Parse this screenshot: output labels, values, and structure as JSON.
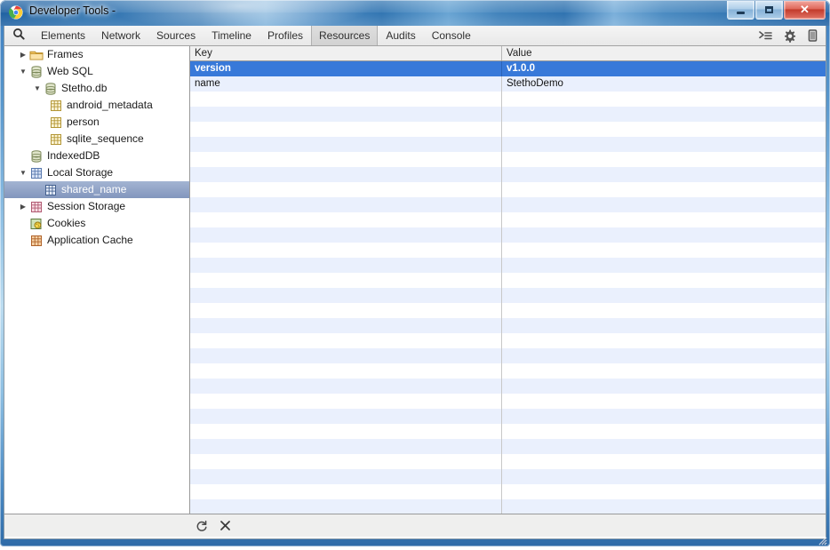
{
  "window": {
    "title": "Developer Tools -",
    "logo_icon": "chrome-logo-icon",
    "controls": {
      "minimize_label": "Minimize",
      "maximize_label": "Maximize",
      "close_label": "✕"
    }
  },
  "toolbar": {
    "search_icon": "search-icon",
    "tabs": [
      {
        "label": "Elements",
        "active": false
      },
      {
        "label": "Network",
        "active": false
      },
      {
        "label": "Sources",
        "active": false
      },
      {
        "label": "Timeline",
        "active": false
      },
      {
        "label": "Profiles",
        "active": false
      },
      {
        "label": "Resources",
        "active": true
      },
      {
        "label": "Audits",
        "active": false
      },
      {
        "label": "Console",
        "active": false
      }
    ],
    "right_icons": [
      {
        "name": "console-drawer-icon",
        "glyph": "⌫"
      },
      {
        "name": "settings-gear-icon",
        "glyph": "⚙"
      },
      {
        "name": "dock-position-icon",
        "glyph": "▯"
      }
    ]
  },
  "sidebar": {
    "items": [
      {
        "label": "Frames",
        "icon": "folder-icon",
        "indent": 0,
        "twisty": "collapsed",
        "selected": false
      },
      {
        "label": "Web SQL",
        "icon": "database-icon",
        "indent": 0,
        "twisty": "expanded",
        "selected": false
      },
      {
        "label": "Stetho.db",
        "icon": "database-icon",
        "indent": 1,
        "twisty": "expanded",
        "selected": false
      },
      {
        "label": "android_metadata",
        "icon": "table-icon",
        "indent": 2,
        "twisty": "none",
        "selected": false
      },
      {
        "label": "person",
        "icon": "table-icon",
        "indent": 2,
        "twisty": "none",
        "selected": false
      },
      {
        "label": "sqlite_sequence",
        "icon": "table-icon",
        "indent": 2,
        "twisty": "none",
        "selected": false
      },
      {
        "label": "IndexedDB",
        "icon": "database-icon",
        "indent": 0,
        "twisty": "none",
        "selected": false
      },
      {
        "label": "Local Storage",
        "icon": "storage-grid-icon",
        "indent": 0,
        "twisty": "expanded",
        "selected": false
      },
      {
        "label": "shared_name",
        "icon": "storage-grid-icon",
        "indent": 1,
        "twisty": "none",
        "selected": true
      },
      {
        "label": "Session Storage",
        "icon": "session-grid-icon",
        "indent": 0,
        "twisty": "collapsed",
        "selected": false
      },
      {
        "label": "Cookies",
        "icon": "cookies-icon",
        "indent": 0,
        "twisty": "none",
        "selected": false
      },
      {
        "label": "Application Cache",
        "icon": "appcache-grid-icon",
        "indent": 0,
        "twisty": "none",
        "selected": false
      }
    ]
  },
  "grid": {
    "columns": [
      {
        "label": "Key"
      },
      {
        "label": "Value"
      }
    ],
    "rows": [
      {
        "key": "version",
        "value": "v1.0.0",
        "selected": true
      },
      {
        "key": "name",
        "value": "StethoDemo",
        "selected": false
      }
    ],
    "empty_row_count": 29
  },
  "bottom_bar": {
    "icons": [
      {
        "name": "refresh-icon",
        "glyph": "↻",
        "title": "Refresh"
      },
      {
        "name": "delete-icon",
        "glyph": "✕",
        "title": "Delete"
      }
    ]
  },
  "colors": {
    "selection_blue": "#3879d9",
    "tree_selection": "#8296bd",
    "row_stripe": "#eaf0fd",
    "frame_blue": "#2f74b2"
  }
}
